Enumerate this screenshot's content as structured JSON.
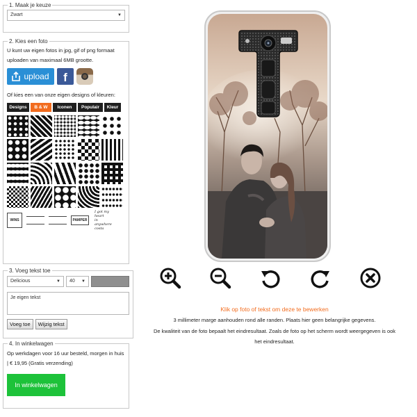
{
  "panel1": {
    "legend": "1. Maak je keuze",
    "select_value": "Zwart"
  },
  "panel2": {
    "legend": "2. Kies een foto",
    "intro": "U kunt uw eigen fotos in jpg, gif of png formaat uploaden van maximaal 6MB grootte.",
    "upload_label": "upload",
    "facebook_glyph": "f",
    "designs_intro": "Of kies een van onze eigen designs of kleuren:",
    "tabs": [
      "Designs",
      "B & W",
      "Iconen",
      "Populair",
      "Kleur"
    ],
    "active_tab": "B & W",
    "logos": [
      "WINS",
      "",
      "",
      "PAMPER",
      "I LOVE MY HEART"
    ],
    "script_lines": [
      "I got my heart",
      "in  anywhere  costa"
    ]
  },
  "panel3": {
    "legend": "3. Voeg tekst toe",
    "font_value": "Delicious",
    "size_value": "40",
    "text_placeholder": "Je eigen tekst",
    "add_label": "Voeg toe",
    "edit_label": "Wijzig tekst"
  },
  "panel4": {
    "legend": "4. In winkelwagen",
    "delivery": "Op werkdagen voor 16 uur besteld, morgen in huis | € 19,95 (Gratis verzending)",
    "cart_label": "In winkelwagen"
  },
  "tools": [
    {
      "name": "zoom-in-icon"
    },
    {
      "name": "zoom-out-icon"
    },
    {
      "name": "rotate-left-icon"
    },
    {
      "name": "rotate-right-icon"
    },
    {
      "name": "delete-icon"
    }
  ],
  "notices": {
    "edit_hint": "Klik op foto of tekst om deze te bewerken",
    "line1": "3 millimeter marge aanhouden rond alle randen. Plaats hier geen belangrijke gegevens.",
    "line2": "De kwaliteit van de foto bepaalt het eindresultaat. Zoals de foto op het scherm wordt weergegeven is ook",
    "line3": "het eindresultaat."
  },
  "colors": {
    "accent": "#f26c1e",
    "upload": "#2a8fd6",
    "cart": "#1dc23a",
    "facebook": "#3b5998"
  }
}
